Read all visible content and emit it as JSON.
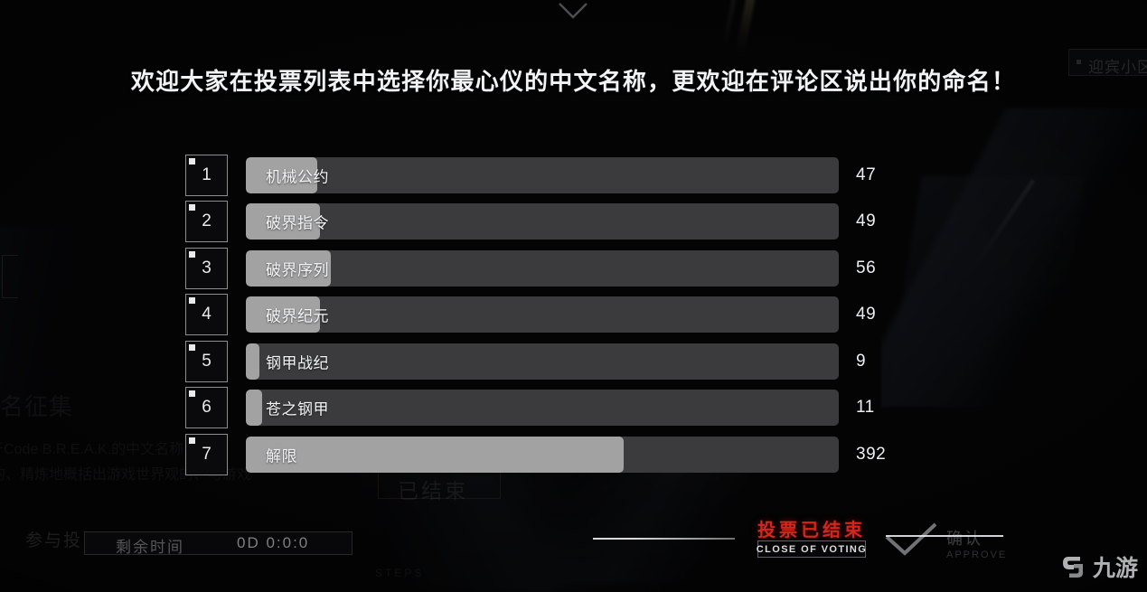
{
  "page": {
    "title": "欢迎大家在投票列表中选择你最心仪的中文名称，更欢迎在评论区说出你的命名！",
    "top_chevron_icon": "chevron-down-icon"
  },
  "vote_list": {
    "max_votes": 392,
    "rows": [
      {
        "rank": "1",
        "name": "机械公约",
        "votes": "47",
        "fill_percent": 12.0
      },
      {
        "rank": "2",
        "name": "破界指令",
        "votes": "49",
        "fill_percent": 12.5
      },
      {
        "rank": "3",
        "name": "破界序列",
        "votes": "56",
        "fill_percent": 14.3
      },
      {
        "rank": "4",
        "name": "破界纪元",
        "votes": "49",
        "fill_percent": 12.5
      },
      {
        "rank": "5",
        "name": "钢甲战纪",
        "votes": "9",
        "fill_percent": 2.3
      },
      {
        "rank": "6",
        "name": "苍之钢甲",
        "votes": "11",
        "fill_percent": 2.8
      },
      {
        "rank": "7",
        "name": "解限",
        "votes": "392",
        "fill_percent": 63.7
      }
    ]
  },
  "status_bar": {
    "timer_label": "剩余时间",
    "timer_value": "0D 0:0:0",
    "closed_cn": "投票已结束",
    "closed_en": "CLOSE OF VOTING",
    "approve_cn": "确认",
    "approve_en": "APPROVE",
    "approve_icon": "check-icon"
  },
  "background": {
    "ghost_title": "名征集",
    "ghost_body_line1": "于Code B.R.E.A.K.的中文名称，以",
    "ghost_body_line2": "的、精炼地概括出游戏世界观的、与游戏",
    "ghost_join_label": "参与投",
    "ghost_ended_label": "已结束",
    "ghost_steps_label": "STEPS",
    "ghost_topright_label": "迎宾小区",
    "ghost_topright_icon": "square-bullet-icon"
  },
  "watermark": {
    "logo_icon": "jiuyou-logo-icon",
    "text": "九游"
  },
  "colors": {
    "background": "#060607",
    "bar_track": "#3b3b3d",
    "bar_fill": "#a2a2a3",
    "accent_red": "#d3261c",
    "text_primary": "#f1f2f4",
    "rank_border": "#8b8d93"
  }
}
